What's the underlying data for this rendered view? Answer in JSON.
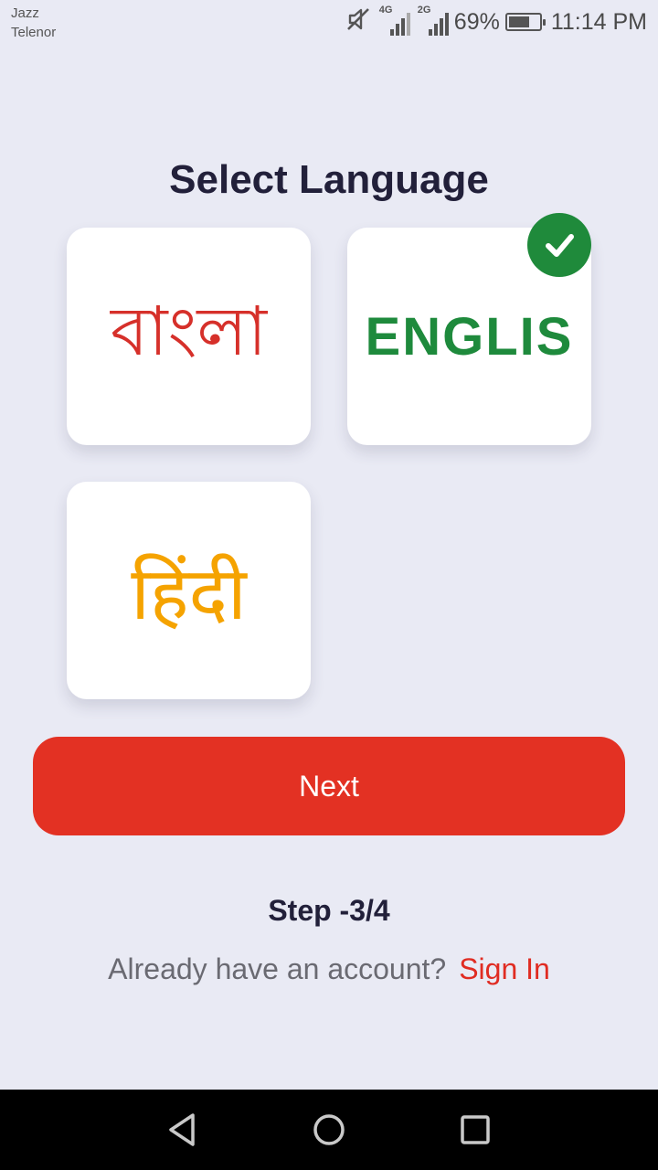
{
  "status_bar": {
    "carrier1": "Jazz",
    "carrier2": "Telenor",
    "net1": "4G",
    "net2": "2G",
    "battery_percent": "69%",
    "battery_level": 0.69,
    "time": "11:14 PM",
    "icons": [
      "mute-icon",
      "signal-icon",
      "signal-icon",
      "battery-icon"
    ]
  },
  "title": "Select Language",
  "languages": [
    {
      "label": "বাংলা",
      "color": "#d6302a",
      "selected": false
    },
    {
      "label": "ENGLIS",
      "color": "#1e8a3c",
      "selected": true
    },
    {
      "label": "हिंदी",
      "color": "#f5a300",
      "selected": false
    }
  ],
  "selected_icon": "check-circle-icon",
  "next_button": {
    "label": "Next",
    "color": "#e33123"
  },
  "step": "Step -3/4",
  "account": {
    "question": "Already have an account?",
    "link": "Sign In"
  },
  "nav_bar": {
    "icons": [
      "back-icon",
      "home-icon",
      "recents-icon"
    ]
  }
}
